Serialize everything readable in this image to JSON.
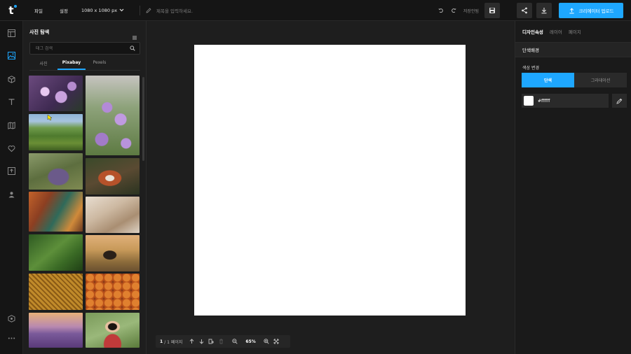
{
  "colors": {
    "accent": "#1ea7ff",
    "bar": "#151515",
    "panel": "#1e1e1e",
    "canvas": "#ffffff"
  },
  "topbar": {
    "logo": "t",
    "menu_file": "파일",
    "menu_settings": "설정",
    "canvas_size": "1080 x 1080 px",
    "title_placeholder": "제목을 입력하세요.",
    "save_status": "저장안됨",
    "upload_label": "크리에이터 업로드"
  },
  "sidebar": {
    "icons": [
      "template-icon",
      "photo-icon",
      "element-icon",
      "text-icon",
      "background-icon",
      "favorite-icon",
      "upload-icon",
      "user-icon",
      "brand-icon",
      "more-icon"
    ]
  },
  "photo_panel": {
    "title": "사진 탐색",
    "search_placeholder": "태그 검색",
    "tabs": [
      {
        "label": "사진",
        "active": false
      },
      {
        "label": "Pixabay",
        "active": true
      },
      {
        "label": "Pexels",
        "active": false
      }
    ],
    "thumbnails": [
      "purple-flowers-butterfly",
      "purple-verbena-flowers",
      "green-mountain-valley",
      "woman-lying-in-flowers",
      "red-panda",
      "colorful-autumn-leaves",
      "knitted-sweater-mug",
      "green-plant-leaves",
      "rottweiler-dog-field",
      "wicker-basket-texture",
      "pomegranates",
      "lavender-field-sunset",
      "woman-in-garden"
    ]
  },
  "canvas": {
    "page_current": "1",
    "page_total": "/ 1 페이지",
    "zoom": "65%"
  },
  "right_panel": {
    "tabs": [
      {
        "label": "디자인속성",
        "active": true
      },
      {
        "label": "레이어",
        "active": false
      },
      {
        "label": "페이지",
        "active": false
      }
    ],
    "section_title": "단색배경",
    "color_change_label": "색상 변경",
    "toggle_solid": "단색",
    "toggle_gradient": "그라데이션",
    "color_value": "#ffffff"
  }
}
